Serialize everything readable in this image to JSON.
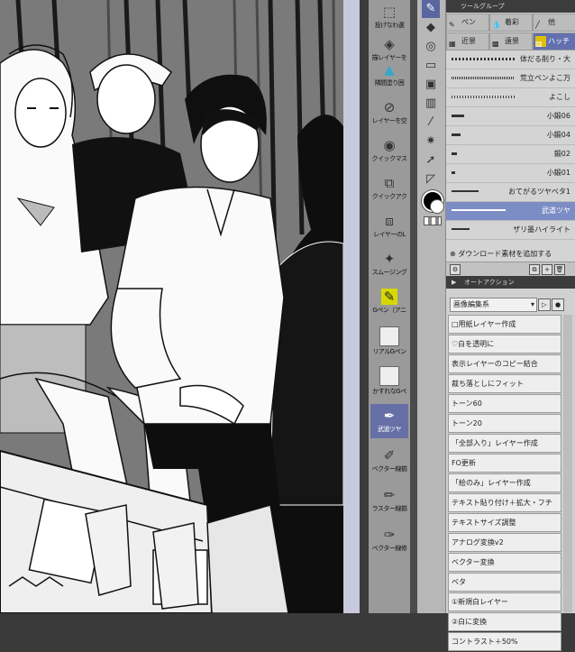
{
  "command_bar": {
    "items": [
      {
        "label": "投げなわ選",
        "icon": "lasso-select-icon"
      },
      {
        "label": "描レイヤーを",
        "icon": "layer-icon"
      },
      {
        "label": "隣間塗り囲",
        "icon": "fill-icon"
      },
      {
        "label": "レイヤーを空",
        "icon": "clear-layer-icon"
      },
      {
        "label": "クイックマス",
        "icon": "quick-mask-icon"
      },
      {
        "label": "クイックアク",
        "icon": "quick-action-icon"
      },
      {
        "label": "レイヤーのL",
        "icon": "layer-l-icon"
      },
      {
        "label": "スムージング",
        "icon": "smoothing-icon"
      },
      {
        "label": "Gペン（アニ",
        "icon": "g-pen-icon"
      },
      {
        "label": "リアルGペン",
        "icon": "real-g-pen-icon"
      },
      {
        "label": "かすれなGペ",
        "icon": "rough-g-pen-icon"
      },
      {
        "label": "武道ツヤ",
        "icon": "pen-icon",
        "active": true
      },
      {
        "label": "ベクター線揃",
        "icon": "vector-line-icon"
      },
      {
        "label": "ラスター線揃",
        "icon": "raster-line-icon"
      },
      {
        "label": "ベクター線修",
        "icon": "vector-fix-icon"
      }
    ]
  },
  "sub_tool": {
    "group_label": "ツールグループ",
    "tabs_row1": [
      {
        "label": "ペン",
        "selected": false
      },
      {
        "label": "着彩",
        "selected": false
      },
      {
        "label": "他",
        "selected": false
      }
    ],
    "tabs_row2": [
      {
        "label": "近景",
        "selected": false
      },
      {
        "label": "遠景",
        "selected": false
      },
      {
        "label": "ハッチ",
        "selected": true
      }
    ],
    "brushes": [
      {
        "name": "体だる削り・大",
        "selected": false
      },
      {
        "name": "荒立ペンよこ万",
        "selected": false
      },
      {
        "name": "よこし",
        "selected": false
      },
      {
        "name": "小鍛06",
        "selected": false
      },
      {
        "name": "小鍛04",
        "selected": false
      },
      {
        "name": "鍛02",
        "selected": false
      },
      {
        "name": "小鍛01",
        "selected": false
      },
      {
        "name": "おてがるツヤベタ1",
        "selected": false
      },
      {
        "name": "武道ツヤ",
        "selected": true
      },
      {
        "name": "ザリ墨ハイライト",
        "selected": false
      }
    ],
    "add_material": "ダウンロード素材を追加する"
  },
  "auto_action": {
    "header": "オートアクション",
    "set_name": "画像編集系",
    "items": [
      "□用紙レイヤー作成",
      "♡白を透明に",
      "表示レイヤーのコピー結合",
      "裁ち落としにフィット",
      "トーン60",
      "トーン20",
      "「全部入り」レイヤー作成",
      "FO更新",
      "「絵のみ」レイヤー作成",
      "テキスト貼り付け＋拡大・フチ",
      "テキストサイズ調整",
      "アナログ変換v2",
      "ベクター変換",
      "ベタ",
      "①新規白レイヤー",
      "②白に変換",
      "コントラスト＋50%"
    ]
  },
  "colors": {
    "accent": "#6670a6",
    "panel_dark": "#3c3c3c",
    "panel_light": "#d0d0d0"
  }
}
